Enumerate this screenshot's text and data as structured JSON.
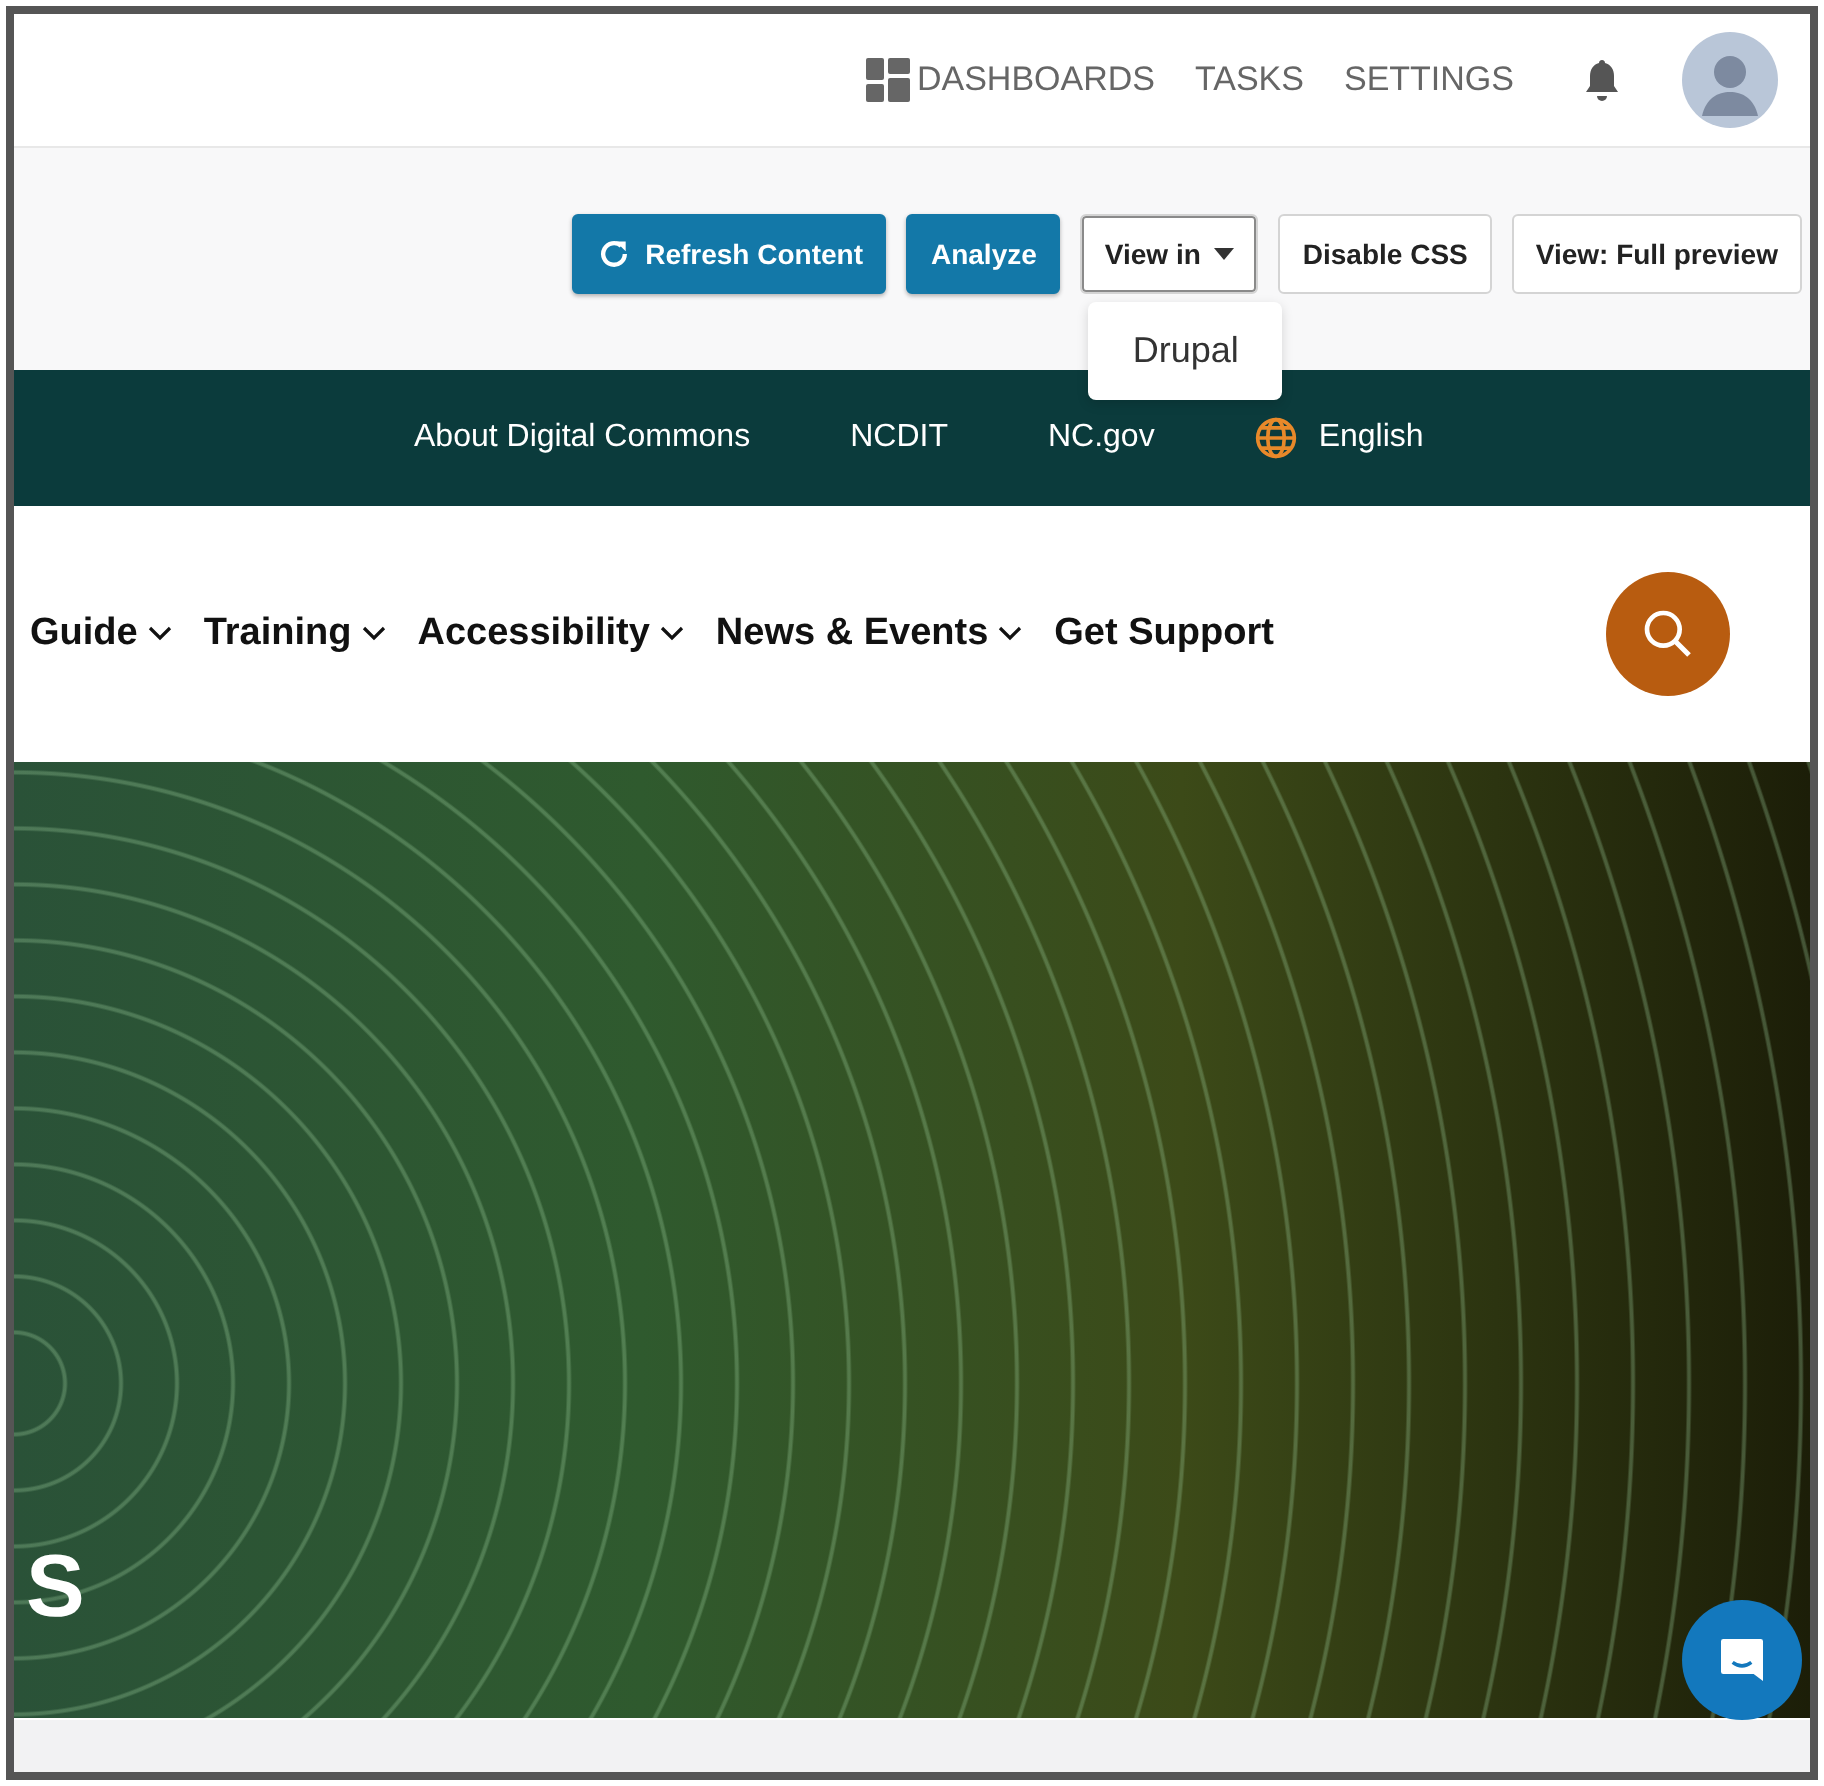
{
  "header": {
    "links": [
      {
        "label": "DASHBOARDS",
        "kind": "dashboards"
      },
      {
        "label": "TASKS",
        "kind": "plain"
      },
      {
        "label": "SETTINGS",
        "kind": "plain"
      }
    ]
  },
  "toolbar": {
    "buttons": [
      {
        "label": "Refresh Content",
        "kind": "refresh"
      },
      {
        "label": "Analyze",
        "kind": "primary"
      },
      {
        "label": "View in",
        "kind": "dropdown",
        "expanded": true,
        "menu": [
          "Drupal"
        ]
      },
      {
        "label": "Disable CSS",
        "kind": "secondary"
      },
      {
        "label": "View: Full preview",
        "kind": "secondary"
      }
    ]
  },
  "utility_bar": {
    "links": [
      {
        "label": "About Digital Commons",
        "kind": "plain"
      },
      {
        "label": "NCDIT",
        "kind": "plain"
      },
      {
        "label": "NC.gov",
        "kind": "plain"
      },
      {
        "label": "English",
        "kind": "language"
      }
    ]
  },
  "main_nav": {
    "items": [
      {
        "label": "Guide",
        "has_dropdown": true
      },
      {
        "label": "Training",
        "has_dropdown": true
      },
      {
        "label": "Accessibility",
        "has_dropdown": true
      },
      {
        "label": "News & Events",
        "has_dropdown": true
      },
      {
        "label": "Get Support",
        "has_dropdown": false
      }
    ]
  },
  "hero": {
    "title": "S"
  }
}
